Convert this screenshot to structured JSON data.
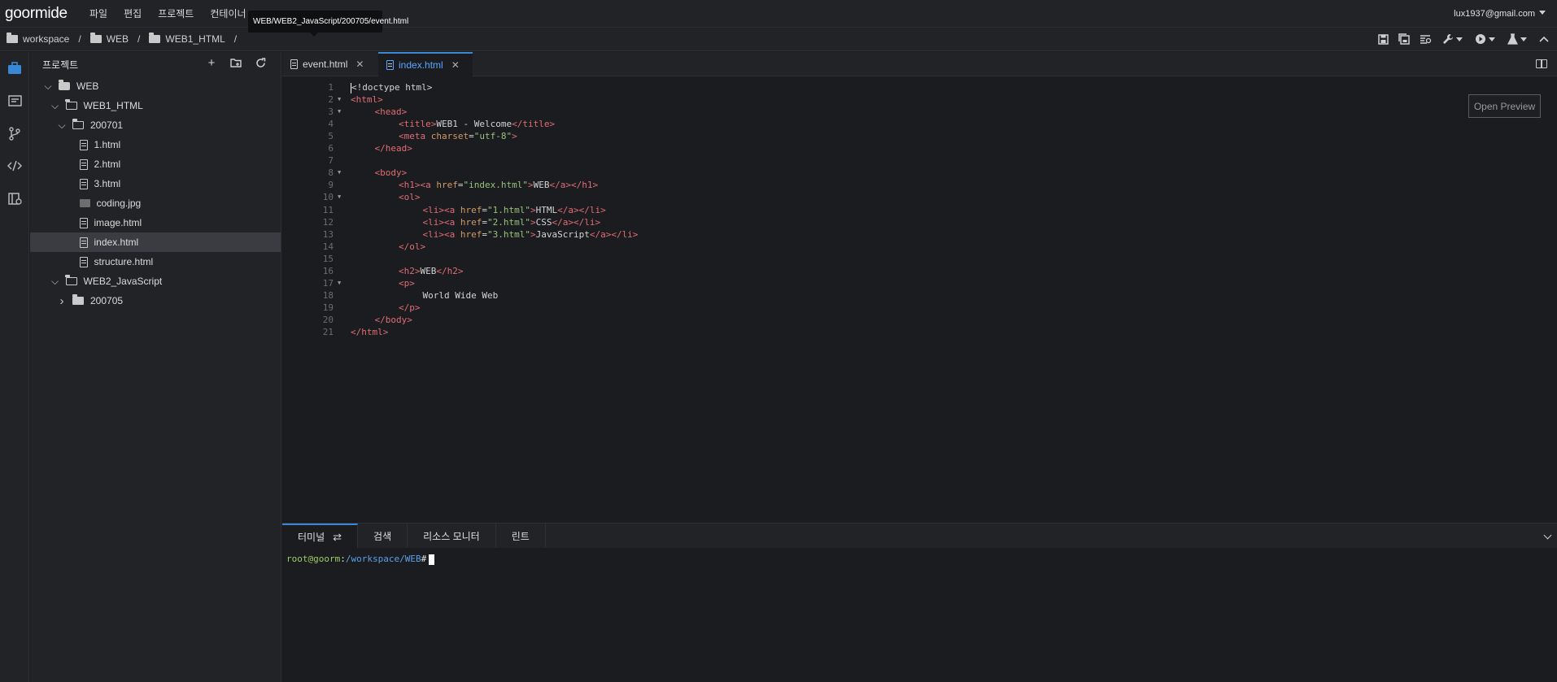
{
  "menubar": {
    "logo": "goormide",
    "items": [
      "파일",
      "편집",
      "프로젝트",
      "컨테이너"
    ],
    "user_email": "lux1937@gmail.com"
  },
  "tooltip": "WEB/WEB2_JavaScript/200705/event.html",
  "breadcrumb": [
    "workspace",
    "WEB",
    "WEB1_HTML"
  ],
  "sidebar": {
    "title": "프로젝트",
    "tree": [
      {
        "label": "WEB",
        "type": "project",
        "depth": 0,
        "expanded": true
      },
      {
        "label": "WEB1_HTML",
        "type": "folder",
        "depth": 1,
        "expanded": true
      },
      {
        "label": "200701",
        "type": "folder",
        "depth": 2,
        "expanded": true
      },
      {
        "label": "1.html",
        "type": "file",
        "depth": 3
      },
      {
        "label": "2.html",
        "type": "file",
        "depth": 3
      },
      {
        "label": "3.html",
        "type": "file",
        "depth": 3
      },
      {
        "label": "coding.jpg",
        "type": "image",
        "depth": 3
      },
      {
        "label": "image.html",
        "type": "file",
        "depth": 3
      },
      {
        "label": "index.html",
        "type": "file",
        "depth": 3,
        "selected": true
      },
      {
        "label": "structure.html",
        "type": "file",
        "depth": 3
      },
      {
        "label": "WEB2_JavaScript",
        "type": "folder",
        "depth": 1,
        "expanded": true
      },
      {
        "label": "200705",
        "type": "folder-closed",
        "depth": 2,
        "expanded": false
      }
    ]
  },
  "tabs": [
    {
      "label": "event.html",
      "active": false
    },
    {
      "label": "index.html",
      "active": true
    }
  ],
  "editor": {
    "preview_button": "Open Preview",
    "lines": [
      {
        "n": "1",
        "fold": false,
        "indent": 0,
        "html": "<span class=\"tx\">&lt;!doctype html&gt;</span>"
      },
      {
        "n": "2",
        "fold": true,
        "indent": 0,
        "html": "<span class=\"tg\">&lt;html&gt;</span>"
      },
      {
        "n": "3",
        "fold": true,
        "indent": 1,
        "html": "<span class=\"tg\">&lt;head&gt;</span>"
      },
      {
        "n": "4",
        "fold": false,
        "indent": 2,
        "html": "<span class=\"tg\">&lt;title&gt;</span><span class=\"tx\">WEB1 - Welcome</span><span class=\"tg\">&lt;/title&gt;</span>"
      },
      {
        "n": "5",
        "fold": false,
        "indent": 2,
        "html": "<span class=\"tg\">&lt;meta </span><span class=\"at\">charset</span><span class=\"tx\">=</span><span class=\"st\">\"utf-8\"</span><span class=\"tg\">&gt;</span>"
      },
      {
        "n": "6",
        "fold": false,
        "indent": 1,
        "html": "<span class=\"tg\">&lt;/head&gt;</span>"
      },
      {
        "n": "7",
        "fold": false,
        "indent": 0,
        "html": ""
      },
      {
        "n": "8",
        "fold": true,
        "indent": 1,
        "html": "<span class=\"tg\">&lt;body&gt;</span>"
      },
      {
        "n": "9",
        "fold": false,
        "indent": 2,
        "html": "<span class=\"tg\">&lt;h1&gt;&lt;a </span><span class=\"at\">href</span><span class=\"tx\">=</span><span class=\"st\">\"index.html\"</span><span class=\"tg\">&gt;</span><span class=\"tx\">WEB</span><span class=\"tg\">&lt;/a&gt;&lt;/h1&gt;</span>"
      },
      {
        "n": "10",
        "fold": true,
        "indent": 2,
        "html": "<span class=\"tg\">&lt;ol&gt;</span>"
      },
      {
        "n": "11",
        "fold": false,
        "indent": 3,
        "html": "<span class=\"tg\">&lt;li&gt;&lt;a </span><span class=\"at\">href</span><span class=\"tx\">=</span><span class=\"st\">\"1.html\"</span><span class=\"tg\">&gt;</span><span class=\"tx\">HTML</span><span class=\"tg\">&lt;/a&gt;&lt;/li&gt;</span>"
      },
      {
        "n": "12",
        "fold": false,
        "indent": 3,
        "html": "<span class=\"tg\">&lt;li&gt;&lt;a </span><span class=\"at\">href</span><span class=\"tx\">=</span><span class=\"st\">\"2.html\"</span><span class=\"tg\">&gt;</span><span class=\"tx\">CSS</span><span class=\"tg\">&lt;/a&gt;&lt;/li&gt;</span>"
      },
      {
        "n": "13",
        "fold": false,
        "indent": 3,
        "html": "<span class=\"tg\">&lt;li&gt;&lt;a </span><span class=\"at\">href</span><span class=\"tx\">=</span><span class=\"st\">\"3.html\"</span><span class=\"tg\">&gt;</span><span class=\"tx\">JavaScript</span><span class=\"tg\">&lt;/a&gt;&lt;/li&gt;</span>"
      },
      {
        "n": "14",
        "fold": false,
        "indent": 2,
        "html": "<span class=\"tg\">&lt;/ol&gt;</span>"
      },
      {
        "n": "15",
        "fold": false,
        "indent": 0,
        "html": ""
      },
      {
        "n": "16",
        "fold": false,
        "indent": 2,
        "html": "<span class=\"tg\">&lt;h2&gt;</span><span class=\"tx\">WEB</span><span class=\"tg\">&lt;/h2&gt;</span>"
      },
      {
        "n": "17",
        "fold": true,
        "indent": 2,
        "html": "<span class=\"tg\">&lt;p&gt;</span>"
      },
      {
        "n": "18",
        "fold": false,
        "indent": 3,
        "html": "<span class=\"tx\">World Wide Web</span>"
      },
      {
        "n": "19",
        "fold": false,
        "indent": 2,
        "html": "<span class=\"tg\">&lt;/p&gt;</span>"
      },
      {
        "n": "20",
        "fold": false,
        "indent": 1,
        "html": "<span class=\"tg\">&lt;/body&gt;</span>"
      },
      {
        "n": "21",
        "fold": false,
        "indent": 0,
        "html": "<span class=\"tg\">&lt;/html&gt;</span>"
      }
    ]
  },
  "panel": {
    "tabs": [
      "터미널",
      "검색",
      "리소스 모니터",
      "린트"
    ],
    "terminal": {
      "user": "root@goorm",
      "sep": ":",
      "path": "/workspace/WEB",
      "prompt": "#"
    }
  },
  "colors": {
    "accent": "#3a87d6",
    "tag": "#e06c75",
    "string": "#98c379",
    "attr": "#d19a66"
  }
}
